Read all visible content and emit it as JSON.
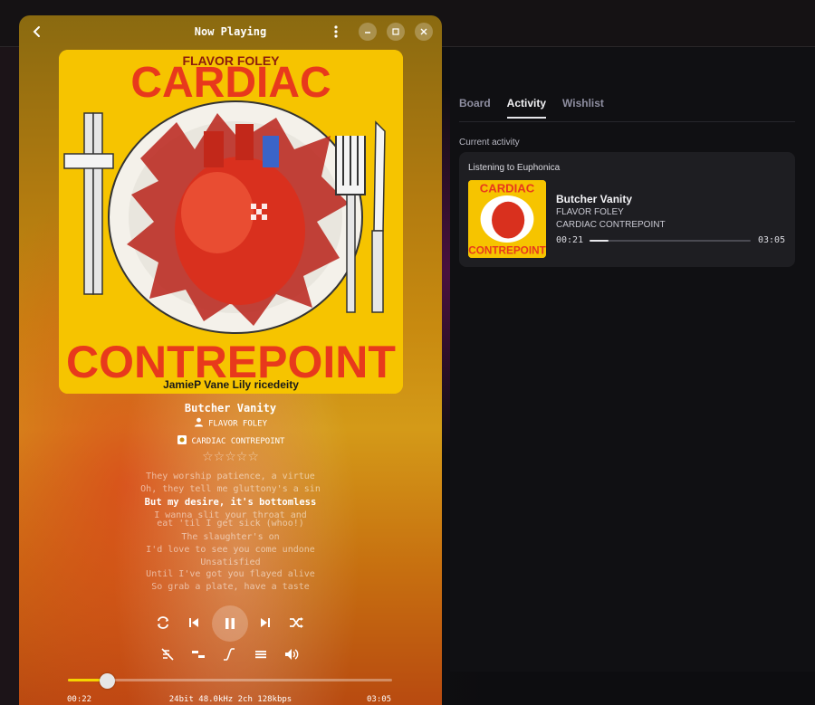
{
  "player": {
    "title": "Now Playing",
    "song": "Butcher Vanity",
    "artist": "FLAVOR FOLEY",
    "album": "CARDIAC CONTREPOINT",
    "rating": 0,
    "rating_stars": "☆☆☆☆☆",
    "album_art": {
      "top_text": "FLAVOR FOLEY",
      "title_top": "CARDIAC",
      "title_bottom": "CONTREPOINT",
      "credits": "JamieP   Vane Lily   ricedeity"
    },
    "lyrics": [
      "They worship patience, a virtue",
      "Oh, they tell me gluttony's a sin",
      "But my desire, it's bottomless",
      "I wanna slit your throat and",
      "eat 'til I get sick (whoo!)",
      "The slaughter's on",
      "I'd love to see you come undone",
      "Unsatisfied",
      "Until I've got you flayed alive",
      "So grab a plate, have a taste"
    ],
    "current_lyric_index": 2,
    "progress_fraction": 0.12,
    "time_elapsed": "00:22",
    "time_total": "03:05",
    "audio_info": "24bit 48.0kHz 2ch  128kbps"
  },
  "panel": {
    "tabs": [
      "Board",
      "Activity",
      "Wishlist"
    ],
    "active_tab": "Activity",
    "current_activity_label": "Current activity",
    "card": {
      "title": "Listening to Euphonica",
      "song": "Butcher Vanity",
      "artist": "FLAVOR FOLEY",
      "album": "CARDIAC CONTREPOINT",
      "time_elapsed": "00:21",
      "time_total": "03:05",
      "progress_fraction": 0.12
    }
  },
  "colors": {
    "accent_seek": "#f5d400",
    "cover_yellow": "#f6c400",
    "cover_red": "#e8391c"
  },
  "icons": [
    "back-icon",
    "kebab-menu-icon",
    "minimize-icon",
    "maximize-icon",
    "close-icon",
    "artist-icon",
    "album-icon",
    "repeat-icon",
    "skip-previous-icon",
    "pause-icon",
    "skip-next-icon",
    "shuffle-icon",
    "lyrics-off-icon",
    "crossfade-icon",
    "curve-icon",
    "queue-icon",
    "volume-icon"
  ]
}
